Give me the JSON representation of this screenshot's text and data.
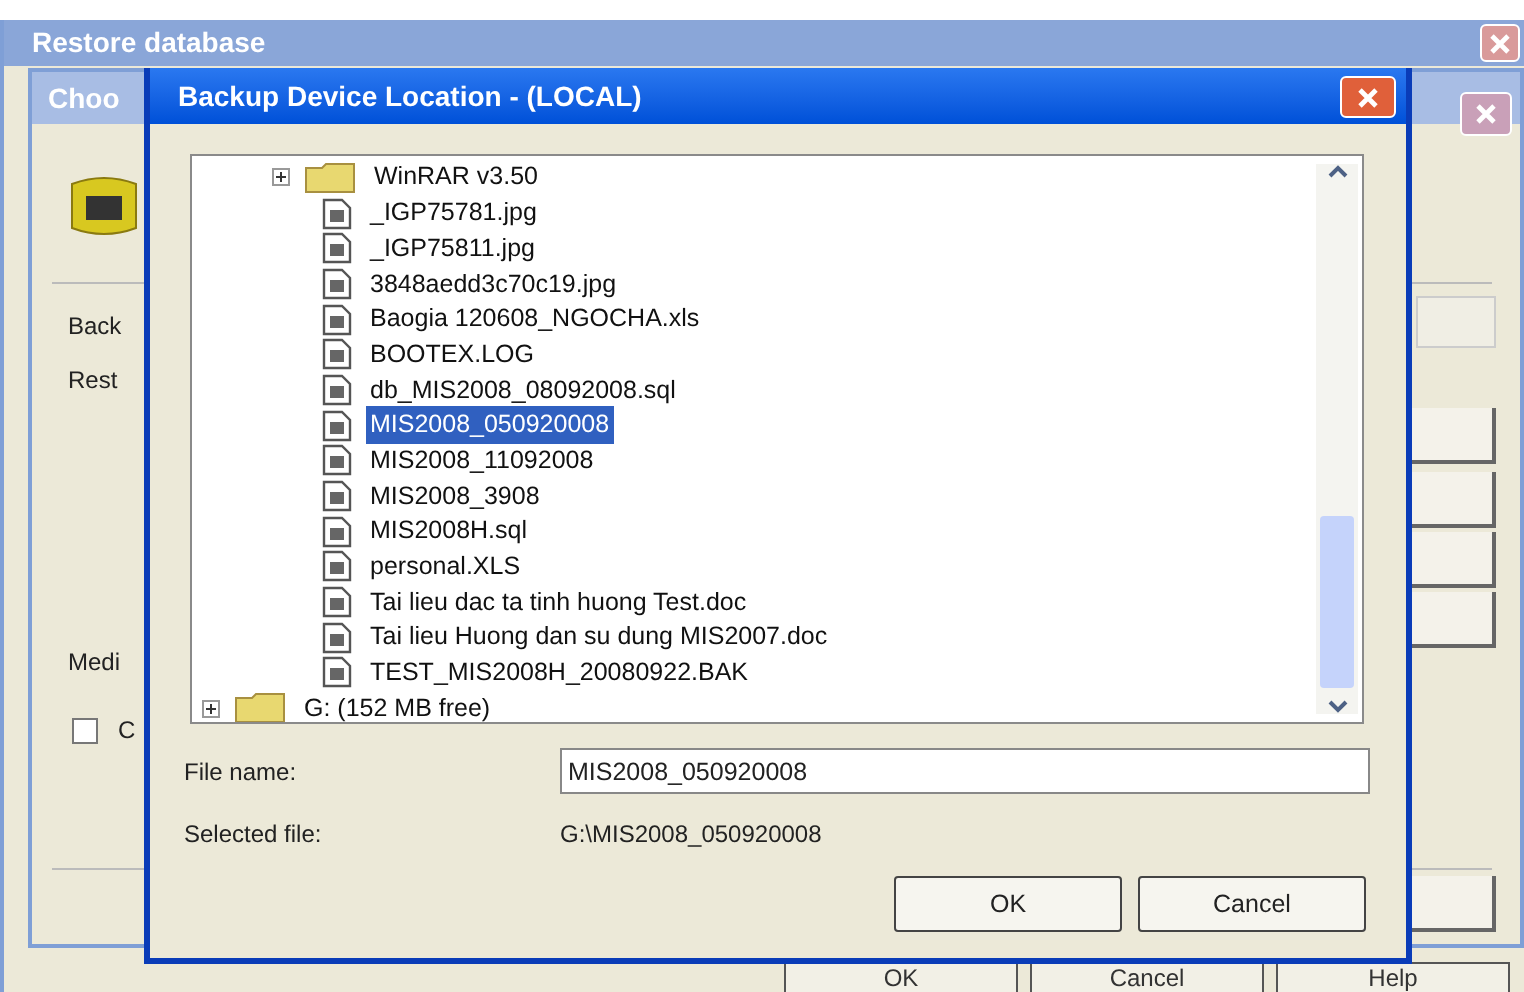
{
  "restore_window": {
    "title": "Restore database",
    "buttons": [
      {
        "label": "OK"
      },
      {
        "label": "Cancel"
      },
      {
        "label": "Help"
      }
    ]
  },
  "choose_window": {
    "title": "Choo",
    "labels": [
      "Back",
      "Rest",
      "Medi"
    ],
    "checkbox": {
      "label": "C",
      "checked": false
    }
  },
  "dialog": {
    "title": "Backup Device Location - (LOCAL)",
    "tree": [
      {
        "kind": "group",
        "children": [
          {
            "kind": "folder",
            "label": "WinRAR v3.50",
            "expanded": false,
            "selected": false
          },
          {
            "kind": "file",
            "label": "_IGP75781.jpg",
            "selected": false
          },
          {
            "kind": "file",
            "label": "_IGP75811.jpg",
            "selected": false
          },
          {
            "kind": "file",
            "label": "3848aedd3c70c19.jpg",
            "selected": false
          },
          {
            "kind": "file",
            "label": "Baogia 120608_NGOCHA.xls",
            "selected": false
          },
          {
            "kind": "file",
            "label": "BOOTEX.LOG",
            "selected": false
          },
          {
            "kind": "file",
            "label": "db_MIS2008_08092008.sql",
            "selected": false
          },
          {
            "kind": "file",
            "label": "MIS2008_050920008",
            "selected": true
          },
          {
            "kind": "file",
            "label": "MIS2008_11092008",
            "selected": false
          },
          {
            "kind": "file",
            "label": "MIS2008_3908",
            "selected": false
          },
          {
            "kind": "file",
            "label": "MIS2008H.sql",
            "selected": false
          },
          {
            "kind": "file",
            "label": "personal.XLS",
            "selected": false
          },
          {
            "kind": "file",
            "label": "Tai lieu dac ta tinh huong Test.doc",
            "selected": false
          },
          {
            "kind": "file",
            "label": "Tai lieu Huong dan su dung MIS2007.doc",
            "selected": false
          },
          {
            "kind": "file",
            "label": "TEST_MIS2008H_20080922.BAK",
            "selected": false
          }
        ]
      },
      {
        "kind": "folder",
        "label": "G: (152 MB free)",
        "expanded": false,
        "selected": false
      }
    ],
    "file_name": {
      "label": "File name:",
      "value": "MIS2008_050920008"
    },
    "selected_file": {
      "label": "Selected file:",
      "value": "G:\\MIS2008_050920008"
    },
    "buttons": [
      {
        "label": "OK"
      },
      {
        "label": "Cancel"
      }
    ]
  }
}
